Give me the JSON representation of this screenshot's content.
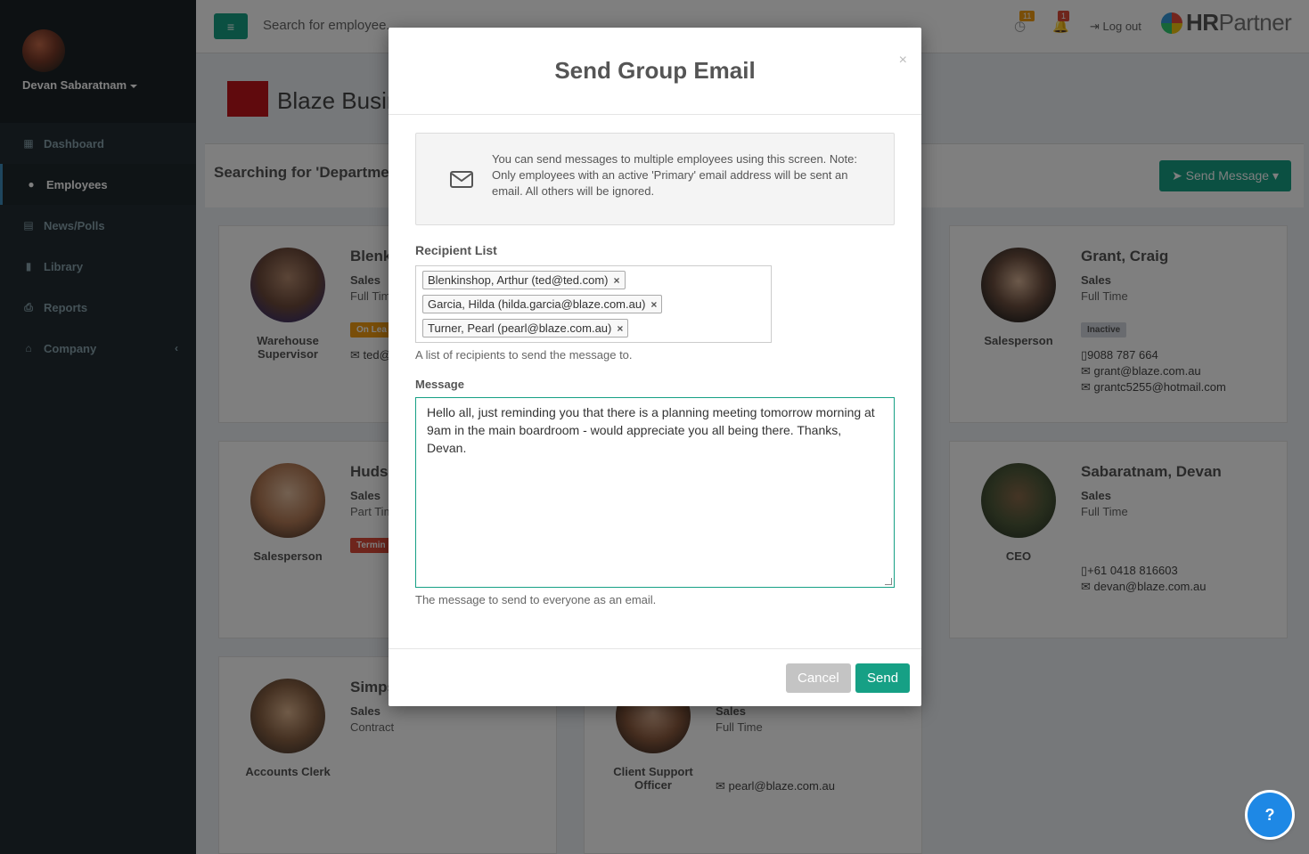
{
  "sidebar": {
    "user_name": "Devan Sabaratnam",
    "items": [
      {
        "label": "Dashboard",
        "icon": "dashboard-icon",
        "glyph": "▦"
      },
      {
        "label": "Employees",
        "icon": "users-icon",
        "glyph": "👥"
      },
      {
        "label": "News/Polls",
        "icon": "newspaper-icon",
        "glyph": "▤"
      },
      {
        "label": "Library",
        "icon": "book-icon",
        "glyph": "▮"
      },
      {
        "label": "Reports",
        "icon": "print-icon",
        "glyph": "⎙"
      },
      {
        "label": "Company",
        "icon": "bank-icon",
        "glyph": "⌂"
      }
    ],
    "active_item": "Employees"
  },
  "header": {
    "search_placeholder": "Search for employee...",
    "clock_badge": "11",
    "bell_badge": "1",
    "logout_label": "Log out",
    "brand_strong": "HR",
    "brand_rest": "Partner"
  },
  "page": {
    "company_name": "Blaze Business",
    "search_heading": "Searching for 'Department",
    "send_message_label": "Send Message"
  },
  "cards": [
    {
      "role": "Warehouse Supervisor",
      "name": "Blenk",
      "dept": "Sales",
      "type": "Full Tim",
      "tag": "On Lea",
      "email": "ted@"
    },
    {
      "role": "Salesperson",
      "name": "Hudso",
      "dept": "Sales",
      "type": "Part Tim",
      "tag": "Termin"
    },
    {
      "role": "Accounts Clerk",
      "name": "Simps",
      "dept": "Sales",
      "type": "Contract"
    },
    {
      "role": "Client Support Officer",
      "dept": "Sales",
      "type": "Full Time",
      "email": "pearl@blaze.com.au"
    },
    {
      "role": "Salesperson",
      "name": "Grant, Craig",
      "dept": "Sales",
      "type": "Full Time",
      "tag": "Inactive",
      "phone": "9088 787 664",
      "email": "grant@blaze.com.au",
      "email2": "grantc5255@hotmail.com"
    },
    {
      "role": "CEO",
      "name": "Sabaratnam, Devan",
      "dept": "Sales",
      "type": "Full Time",
      "phone": "+61 0418 816603",
      "email": "devan@blaze.com.au"
    }
  ],
  "modal": {
    "title": "Send Group Email",
    "close": "×",
    "info_text": "You can send messages to multiple employees using this screen. Note: Only employees with an active 'Primary' email address will be sent an email. All others will be ignored.",
    "recipient_label": "Recipient List",
    "recipients": [
      "Blenkinshop, Arthur (ted@ted.com)",
      "Garcia, Hilda (hilda.garcia@blaze.com.au)",
      "Turner, Pearl (pearl@blaze.com.au)"
    ],
    "recipient_help": "A list of recipients to send the message to.",
    "message_label": "Message",
    "message_value": "Hello all, just reminding you that there is a planning meeting tomorrow morning at 9am in the main boardroom - would appreciate you all being there. Thanks, Devan.",
    "message_help": "The message to send to everyone as an email.",
    "cancel_label": "Cancel",
    "send_label": "Send"
  },
  "colors": {
    "accent": "#16a085",
    "sidebar": "#222d32",
    "on_leave": "#f39c12",
    "terminated": "#dd4b39",
    "inactive": "#d2d6de"
  }
}
